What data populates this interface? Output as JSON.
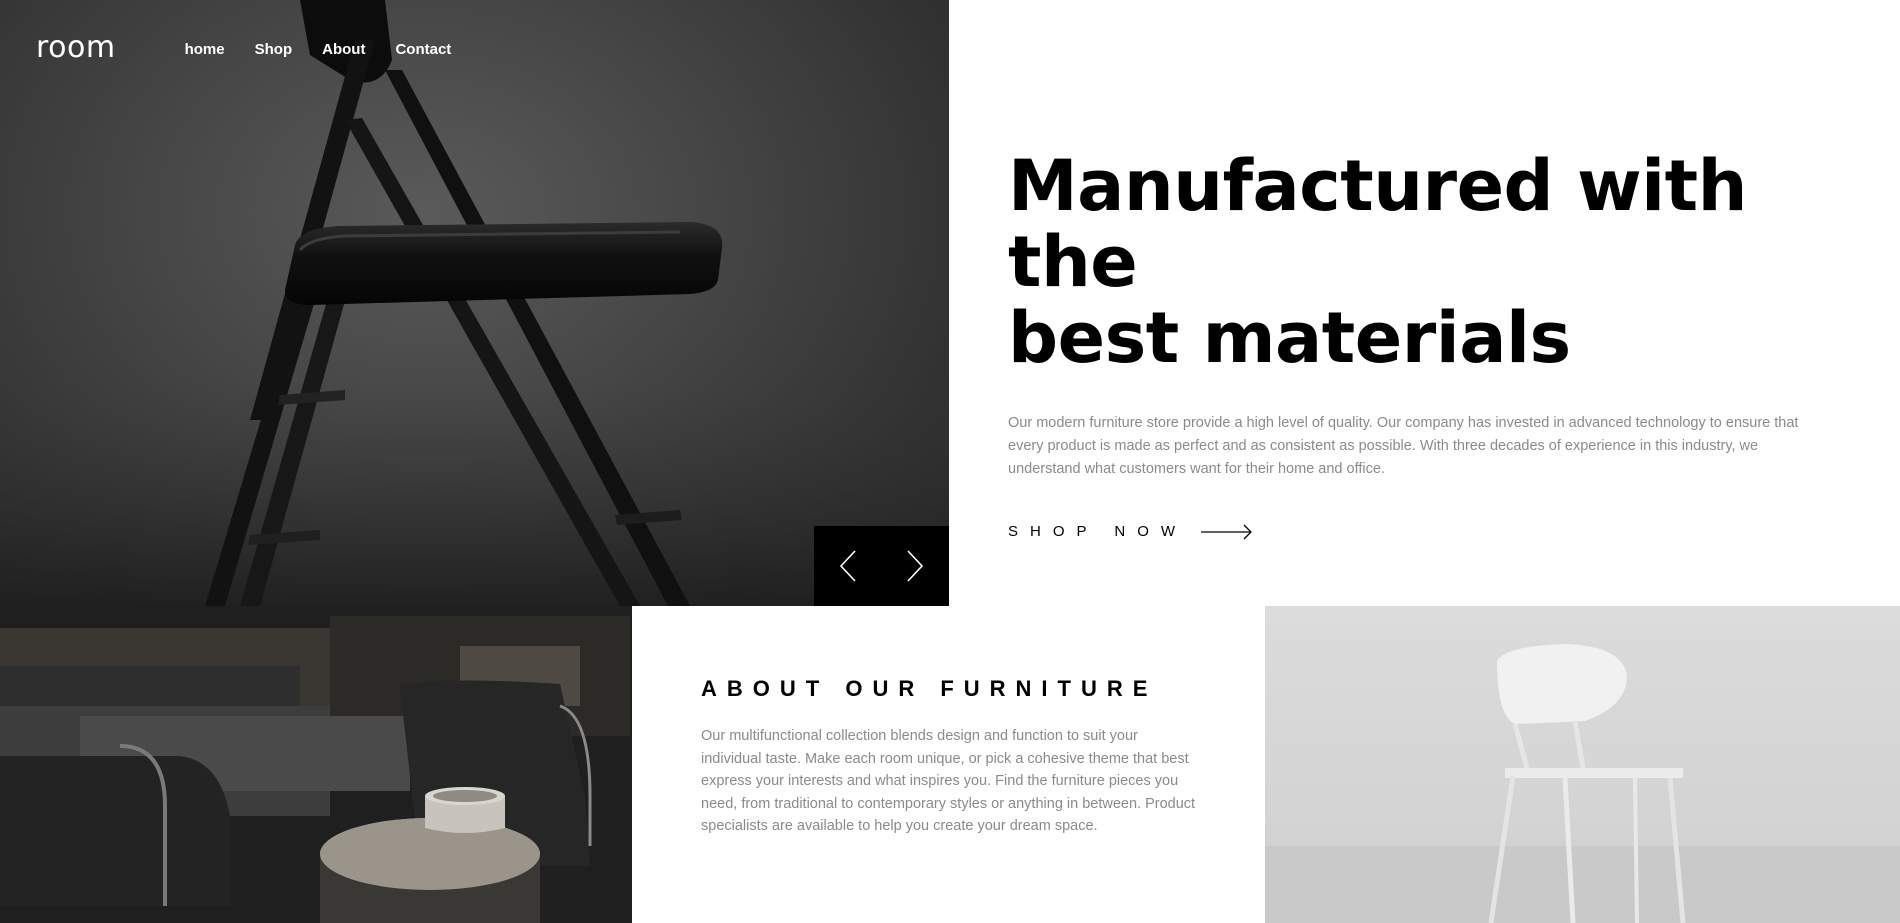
{
  "nav": {
    "logo": "room",
    "links": [
      "home",
      "Shop",
      "About",
      "Contact"
    ]
  },
  "hero": {
    "title_line1": "Manufactured with the",
    "title_line2": "best materials",
    "description": "Our modern furniture store provide a high level of quality. Our company has invested in advanced technology to ensure that every product is made as perfect and as consistent as possible. With three decades of experience in this industry, we understand what customers want for their home and office.",
    "cta_label": "SHOP NOW",
    "prev_icon": "chevron-left-icon",
    "next_icon": "chevron-right-icon",
    "cta_icon": "arrow-right-icon"
  },
  "about": {
    "title": "ABOUT OUR FURNITURE",
    "description": "Our multifunctional collection blends design and function to suit your individual taste. Make each room unique, or pick a cohesive theme that best express your interests and what inspires you. Find the furniture pieces you need, from traditional to contemporary styles or anything in between. Product specialists are available to help you create your dream space."
  },
  "colors": {
    "text_primary": "#000000",
    "text_secondary": "#8a8a8f",
    "background": "#ffffff",
    "slider_bg": "#000000"
  }
}
